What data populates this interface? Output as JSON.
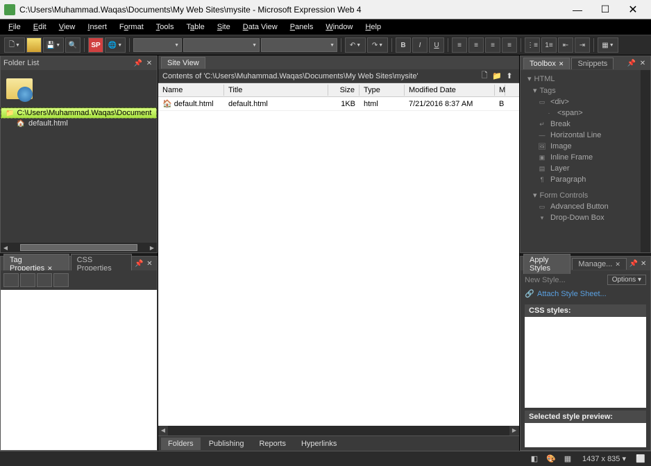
{
  "titlebar": {
    "title": "C:\\Users\\Muhammad.Waqas\\Documents\\My Web Sites\\mysite - Microsoft Expression Web 4"
  },
  "menu": {
    "file": "File",
    "edit": "Edit",
    "view": "View",
    "insert": "Insert",
    "format": "Format",
    "tools": "Tools",
    "table": "Table",
    "site": "Site",
    "dataview": "Data View",
    "panels": "Panels",
    "window": "Window",
    "help": "Help"
  },
  "folderList": {
    "title": "Folder List",
    "path": "C:\\Users\\Muhammad.Waqas\\Documents\\My Web Sites\\mysite",
    "file": "default.html"
  },
  "tagProps": {
    "tab1": "Tag Properties",
    "tab2": "CSS Properties"
  },
  "siteView": {
    "tab": "Site View",
    "contents": "Contents of 'C:\\Users\\Muhammad.Waqas\\Documents\\My Web Sites\\mysite'",
    "cols": {
      "name": "Name",
      "title": "Title",
      "size": "Size",
      "type": "Type",
      "modified": "Modified Date",
      "m": "M"
    },
    "row": {
      "name": "default.html",
      "title": "default.html",
      "size": "1KB",
      "type": "html",
      "modified": "7/21/2016 8:37 AM",
      "m": "B"
    },
    "bottomTabs": {
      "folders": "Folders",
      "publishing": "Publishing",
      "reports": "Reports",
      "hyperlinks": "Hyperlinks"
    }
  },
  "toolbox": {
    "tab1": "Toolbox",
    "tab2": "Snippets",
    "groups": {
      "html": "HTML",
      "tags": "Tags",
      "formControls": "Form Controls"
    },
    "items": {
      "div": "<div>",
      "span": "<span>",
      "break": "Break",
      "hr": "Horizontal Line",
      "image": "Image",
      "iframe": "Inline Frame",
      "layer": "Layer",
      "paragraph": "Paragraph",
      "advButton": "Advanced Button",
      "dropdown": "Drop-Down Box"
    }
  },
  "styles": {
    "tab1": "Apply Styles",
    "tab2": "Manage...",
    "newStyle": "New Style...",
    "options": "Options",
    "attach": "Attach Style Sheet...",
    "cssStyles": "CSS styles:",
    "selectedPreview": "Selected style preview:"
  },
  "status": {
    "dimensions": "1437 x 835"
  }
}
